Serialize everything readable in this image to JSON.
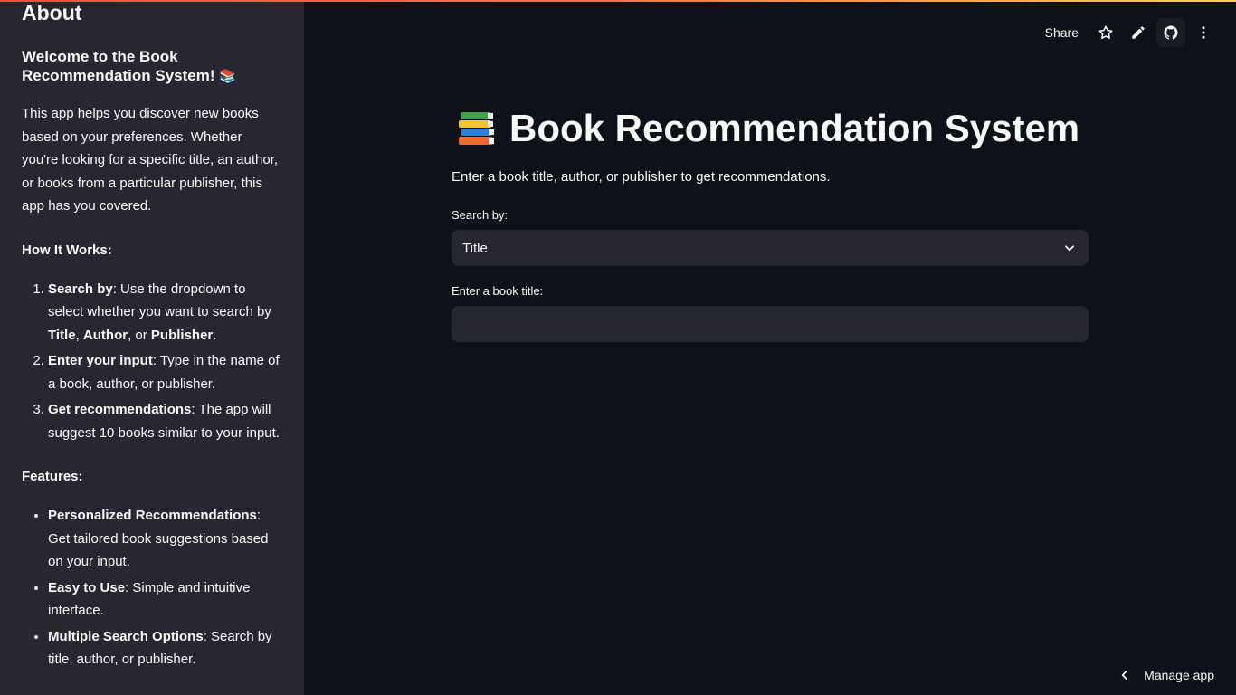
{
  "sidebar": {
    "heading": "About",
    "welcome": "Welcome to the Book Recommendation System!",
    "welcome_emoji": "📚",
    "intro": "This app helps you discover new books based on your preferences. Whether you're looking for a specific title, an author, or books from a particular publisher, this app has you covered.",
    "how_heading": "How It Works:",
    "steps": [
      {
        "bold": "Search by",
        "text_a": ": Use the dropdown to select whether you want to search by ",
        "b1": "Title",
        "sep1": ", ",
        "b2": "Author",
        "sep2": ", or ",
        "b3": "Publisher",
        "end": "."
      },
      {
        "bold": "Enter your input",
        "text": ": Type in the name of a book, author, or publisher."
      },
      {
        "bold": "Get recommendations",
        "text": ": The app will suggest 10 books similar to your input."
      }
    ],
    "features_heading": "Features:",
    "features": [
      {
        "bold": "Personalized Recommendations",
        "text": ": Get tailored book suggestions based on your input."
      },
      {
        "bold": "Easy to Use",
        "text": ": Simple and intuitive interface."
      },
      {
        "bold": "Multiple Search Options",
        "text": ": Search by title, author, or publisher."
      }
    ]
  },
  "toolbar": {
    "share_label": "Share",
    "icons": [
      "star-icon",
      "pencil-icon",
      "github-icon",
      "more-vert-icon"
    ]
  },
  "main": {
    "title": "Book Recommendation System",
    "title_icon": "books-icon",
    "subtitle": "Enter a book title, author, or publisher to get recommendations.",
    "search_by_label": "Search by:",
    "search_by_value": "Title",
    "input_label": "Enter a book title:",
    "input_value": ""
  },
  "footer": {
    "manage_label": "Manage app"
  },
  "colors": {
    "background": "#0e1117",
    "sidebar": "#262730",
    "input_bg": "#262730",
    "text": "#fafafa",
    "accent_gradient_start": "#ff4b4b",
    "accent_gradient_end": "#ffd34b"
  }
}
